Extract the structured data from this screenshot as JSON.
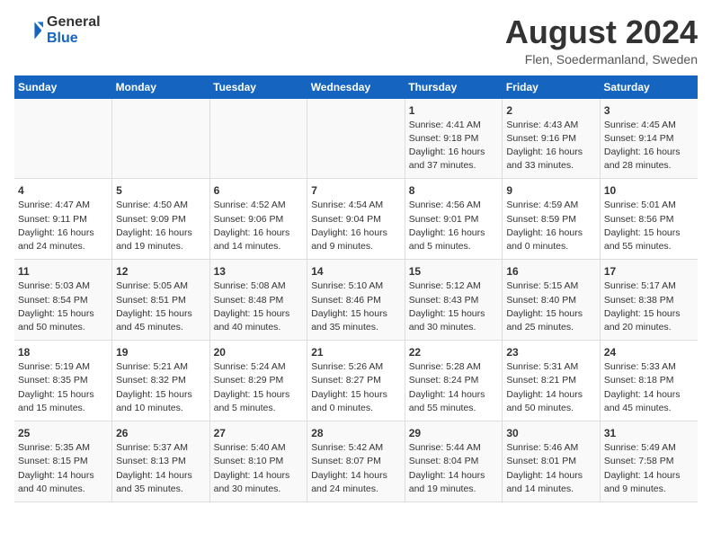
{
  "header": {
    "logo_general": "General",
    "logo_blue": "Blue",
    "month_title": "August 2024",
    "location": "Flen, Soedermanland, Sweden"
  },
  "days_of_week": [
    "Sunday",
    "Monday",
    "Tuesday",
    "Wednesday",
    "Thursday",
    "Friday",
    "Saturday"
  ],
  "weeks": [
    [
      {
        "day": "",
        "info": ""
      },
      {
        "day": "",
        "info": ""
      },
      {
        "day": "",
        "info": ""
      },
      {
        "day": "",
        "info": ""
      },
      {
        "day": "1",
        "info": "Sunrise: 4:41 AM\nSunset: 9:18 PM\nDaylight: 16 hours and 37 minutes."
      },
      {
        "day": "2",
        "info": "Sunrise: 4:43 AM\nSunset: 9:16 PM\nDaylight: 16 hours and 33 minutes."
      },
      {
        "day": "3",
        "info": "Sunrise: 4:45 AM\nSunset: 9:14 PM\nDaylight: 16 hours and 28 minutes."
      }
    ],
    [
      {
        "day": "4",
        "info": "Sunrise: 4:47 AM\nSunset: 9:11 PM\nDaylight: 16 hours and 24 minutes."
      },
      {
        "day": "5",
        "info": "Sunrise: 4:50 AM\nSunset: 9:09 PM\nDaylight: 16 hours and 19 minutes."
      },
      {
        "day": "6",
        "info": "Sunrise: 4:52 AM\nSunset: 9:06 PM\nDaylight: 16 hours and 14 minutes."
      },
      {
        "day": "7",
        "info": "Sunrise: 4:54 AM\nSunset: 9:04 PM\nDaylight: 16 hours and 9 minutes."
      },
      {
        "day": "8",
        "info": "Sunrise: 4:56 AM\nSunset: 9:01 PM\nDaylight: 16 hours and 5 minutes."
      },
      {
        "day": "9",
        "info": "Sunrise: 4:59 AM\nSunset: 8:59 PM\nDaylight: 16 hours and 0 minutes."
      },
      {
        "day": "10",
        "info": "Sunrise: 5:01 AM\nSunset: 8:56 PM\nDaylight: 15 hours and 55 minutes."
      }
    ],
    [
      {
        "day": "11",
        "info": "Sunrise: 5:03 AM\nSunset: 8:54 PM\nDaylight: 15 hours and 50 minutes."
      },
      {
        "day": "12",
        "info": "Sunrise: 5:05 AM\nSunset: 8:51 PM\nDaylight: 15 hours and 45 minutes."
      },
      {
        "day": "13",
        "info": "Sunrise: 5:08 AM\nSunset: 8:48 PM\nDaylight: 15 hours and 40 minutes."
      },
      {
        "day": "14",
        "info": "Sunrise: 5:10 AM\nSunset: 8:46 PM\nDaylight: 15 hours and 35 minutes."
      },
      {
        "day": "15",
        "info": "Sunrise: 5:12 AM\nSunset: 8:43 PM\nDaylight: 15 hours and 30 minutes."
      },
      {
        "day": "16",
        "info": "Sunrise: 5:15 AM\nSunset: 8:40 PM\nDaylight: 15 hours and 25 minutes."
      },
      {
        "day": "17",
        "info": "Sunrise: 5:17 AM\nSunset: 8:38 PM\nDaylight: 15 hours and 20 minutes."
      }
    ],
    [
      {
        "day": "18",
        "info": "Sunrise: 5:19 AM\nSunset: 8:35 PM\nDaylight: 15 hours and 15 minutes."
      },
      {
        "day": "19",
        "info": "Sunrise: 5:21 AM\nSunset: 8:32 PM\nDaylight: 15 hours and 10 minutes."
      },
      {
        "day": "20",
        "info": "Sunrise: 5:24 AM\nSunset: 8:29 PM\nDaylight: 15 hours and 5 minutes."
      },
      {
        "day": "21",
        "info": "Sunrise: 5:26 AM\nSunset: 8:27 PM\nDaylight: 15 hours and 0 minutes."
      },
      {
        "day": "22",
        "info": "Sunrise: 5:28 AM\nSunset: 8:24 PM\nDaylight: 14 hours and 55 minutes."
      },
      {
        "day": "23",
        "info": "Sunrise: 5:31 AM\nSunset: 8:21 PM\nDaylight: 14 hours and 50 minutes."
      },
      {
        "day": "24",
        "info": "Sunrise: 5:33 AM\nSunset: 8:18 PM\nDaylight: 14 hours and 45 minutes."
      }
    ],
    [
      {
        "day": "25",
        "info": "Sunrise: 5:35 AM\nSunset: 8:15 PM\nDaylight: 14 hours and 40 minutes."
      },
      {
        "day": "26",
        "info": "Sunrise: 5:37 AM\nSunset: 8:13 PM\nDaylight: 14 hours and 35 minutes."
      },
      {
        "day": "27",
        "info": "Sunrise: 5:40 AM\nSunset: 8:10 PM\nDaylight: 14 hours and 30 minutes."
      },
      {
        "day": "28",
        "info": "Sunrise: 5:42 AM\nSunset: 8:07 PM\nDaylight: 14 hours and 24 minutes."
      },
      {
        "day": "29",
        "info": "Sunrise: 5:44 AM\nSunset: 8:04 PM\nDaylight: 14 hours and 19 minutes."
      },
      {
        "day": "30",
        "info": "Sunrise: 5:46 AM\nSunset: 8:01 PM\nDaylight: 14 hours and 14 minutes."
      },
      {
        "day": "31",
        "info": "Sunrise: 5:49 AM\nSunset: 7:58 PM\nDaylight: 14 hours and 9 minutes."
      }
    ]
  ]
}
